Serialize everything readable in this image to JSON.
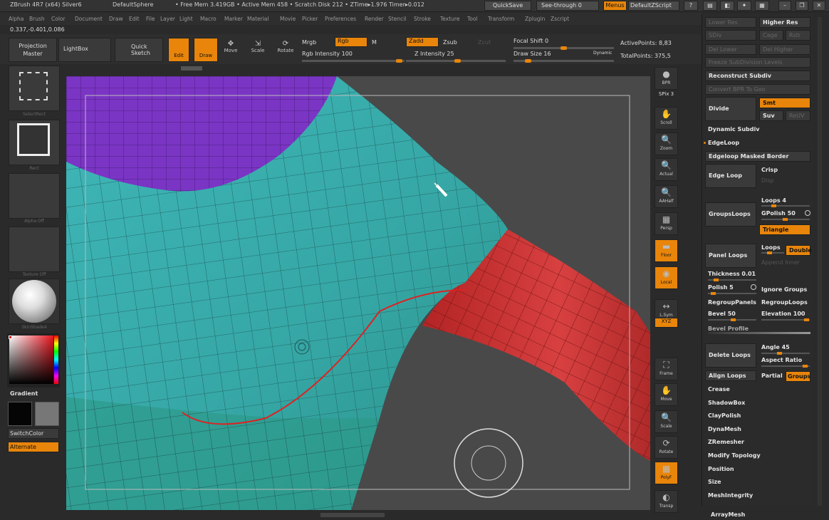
{
  "titlebar": {
    "app": "ZBrush 4R7 (x64) Silver6",
    "doc": "DefaultSphere",
    "mem": "• Free Mem 3.419GB • Active Mem 458 • Scratch Disk 212 • ZTime▸1.976 Timer▸0.012",
    "quicksave": "QuickSave",
    "seethrough": "See-through  0",
    "menus": "Menus",
    "script": "DefaultZScript"
  },
  "menubar": [
    "Alpha",
    "Brush",
    "Color",
    "Document",
    "Draw",
    "Edit",
    "File",
    "Layer",
    "Light",
    "Macro",
    "Marker",
    "Material",
    "Movie",
    "Picker",
    "Preferences",
    "Render",
    "Stencil",
    "Stroke",
    "Texture",
    "Tool",
    "Transform",
    "Zplugin",
    "Zscript"
  ],
  "coords": "0.337,-0.401,0.086",
  "toolbar": {
    "projection": "Projection Master",
    "lightbox": "LightBox",
    "quicksketch": "Quick Sketch",
    "edit": "Edit",
    "draw": "Draw",
    "move": "Move",
    "scale": "Scale",
    "rotate": "Rotate",
    "mrgb": "Mrgb",
    "rgb": "Rgb",
    "m": "M",
    "rgb_intensity": "Rgb Intensity 100",
    "zadd": "Zadd",
    "zsub": "Zsub",
    "zcut": "Zcut",
    "z_intensity": "Z Intensity 25",
    "focal": "Focal Shift 0",
    "drawsize": "Draw Size 16",
    "dynamic": "Dynamic",
    "active": "ActivePoints: 8,83",
    "total": "TotalPoints: 375,5"
  },
  "leftshelf": {
    "select": "SelectRect",
    "rect": "Rect",
    "alpha": "Alpha Off",
    "texture": "Texture Off",
    "material": "SkinShade4",
    "gradient": "Gradient",
    "switch": "SwitchColor",
    "alternate": "Alternate"
  },
  "rightshelf": [
    {
      "name": "bpr",
      "label": "BPR",
      "icon": "●"
    },
    {
      "name": "spix",
      "label": "SPix 3",
      "icon": ""
    },
    {
      "name": "scroll",
      "label": "Scroll",
      "icon": "✋"
    },
    {
      "name": "zoom",
      "label": "Zoom",
      "icon": "🔍"
    },
    {
      "name": "actual",
      "label": "Actual",
      "icon": "🔍"
    },
    {
      "name": "aahalf",
      "label": "AAHalf",
      "icon": "🔍"
    },
    {
      "name": "persp",
      "label": "Persp",
      "icon": "▦"
    },
    {
      "name": "floor",
      "label": "Floor",
      "icon": "▬"
    },
    {
      "name": "local",
      "label": "Local",
      "icon": "◉"
    },
    {
      "name": "lsym",
      "label": "L.Sym",
      "icon": "↔"
    },
    {
      "name": "xyz",
      "label": "XYZ",
      "icon": ""
    },
    {
      "name": "frame",
      "label": "Frame",
      "icon": "⛶"
    },
    {
      "name": "move",
      "label": "Move",
      "icon": "✋"
    },
    {
      "name": "scale",
      "label": "Scale",
      "icon": "🔍"
    },
    {
      "name": "rotate",
      "label": "Rotate",
      "icon": "⟳"
    },
    {
      "name": "polyf",
      "label": "PolyF",
      "icon": "▦"
    },
    {
      "name": "transp",
      "label": "Transp",
      "icon": "◐"
    }
  ],
  "panel": {
    "lower_res": "Lower Res",
    "higher_res": "Higher Res",
    "sdiv": "SDiv",
    "del_lower": "Del Lower",
    "del_higher": "Del Higher",
    "freeze": "Freeze SubDivision Levels",
    "reconstruct": "Reconstruct Subdiv",
    "convert": "Convert BPR To Geo",
    "divide": "Divide",
    "smt": "Smt",
    "suv": "Suv",
    "rsmt": "ReUV",
    "dynamic_subdiv": "Dynamic Subdiv",
    "edgeloop": "EdgeLoop",
    "edgeloop_masked": "Edgeloop Masked Border",
    "edge_loop": "Edge Loop",
    "crisp": "Crisp",
    "disp": "Disp",
    "groupsloops": "GroupsLoops",
    "loops4": "Loops 4",
    "gpolish": "GPolish 50",
    "triangle": "Triangle",
    "panel_loops": "Panel Loops",
    "loops": "Loops",
    "double": "Double",
    "append": "Append Inner",
    "thickness": "Thickness 0.01",
    "polish": "Polish 5",
    "ignore_groups": "Ignore Groups",
    "regroup_panels": "RegroupPanels",
    "regroup_loops": "RegroupLoops",
    "bevel": "Bevel 50",
    "elevation": "Elevation 100",
    "bevel_profile": "Bevel Profile",
    "delete_loops": "Delete Loops",
    "angle": "Angle 45",
    "aspect": "Aspect Ratio",
    "align_loops": "Align Loops",
    "partial": "Partial",
    "groups": "Groups",
    "crease": "Crease",
    "shadowbox": "ShadowBox",
    "claypolish": "ClayPolish",
    "dynamesh": "DynaMesh",
    "zremesher": "ZRemesher",
    "modify": "Modify Topology",
    "position": "Position",
    "size": "Size",
    "meshintegrity": "MeshIntegrity",
    "arraymesh": "ArrayMesh"
  }
}
